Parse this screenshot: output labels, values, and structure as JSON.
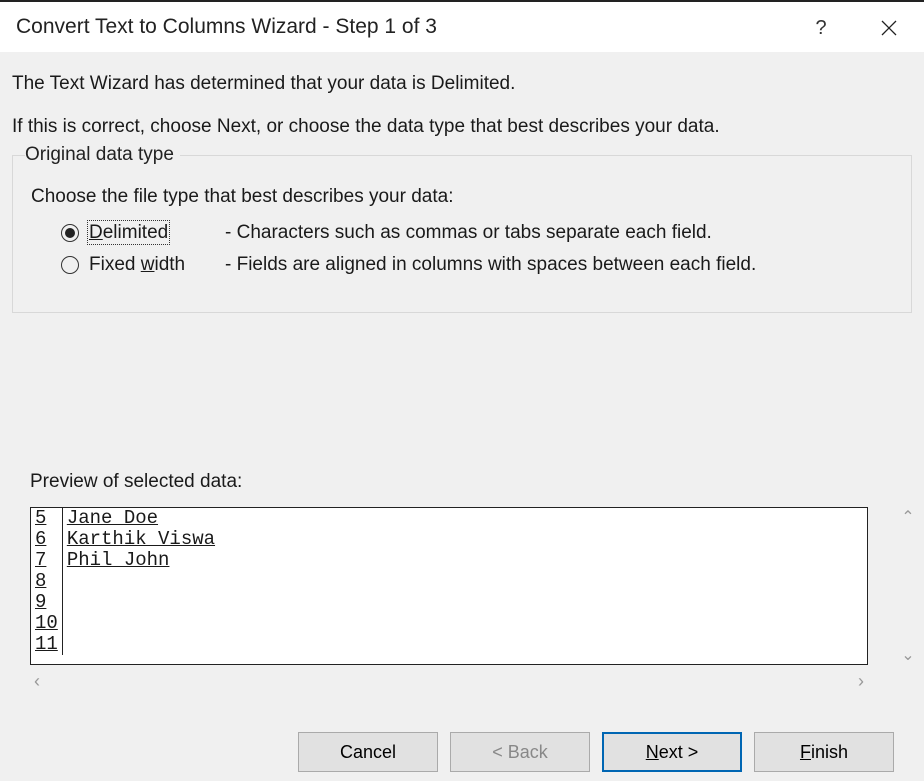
{
  "title": "Convert Text to Columns Wizard - Step 1 of 3",
  "intro": {
    "line1": "The Text Wizard has determined that your data is Delimited.",
    "line2": "If this is correct, choose Next, or choose the data type that best describes your data."
  },
  "fieldset": {
    "legend": "Original data type",
    "prompt": "Choose the file type that best describes your data:",
    "options": [
      {
        "label_pre": "",
        "accel": "D",
        "label_post": "elimited",
        "desc": "- Characters such as commas or tabs separate each field.",
        "checked": true,
        "focused": true
      },
      {
        "label_pre": "Fixed ",
        "accel": "w",
        "label_post": "idth",
        "desc": "- Fields are aligned in columns with spaces between each field.",
        "checked": false,
        "focused": false
      }
    ]
  },
  "preview": {
    "label": "Preview of selected data:",
    "rows": [
      {
        "n": "5",
        "text": "Jane Doe"
      },
      {
        "n": "6",
        "text": "Karthik Viswa"
      },
      {
        "n": "7",
        "text": "Phil John"
      },
      {
        "n": "8",
        "text": ""
      },
      {
        "n": "9",
        "text": ""
      },
      {
        "n": "10",
        "text": ""
      },
      {
        "n": "11",
        "text": ""
      }
    ]
  },
  "buttons": {
    "cancel": "Cancel",
    "back": "< Back",
    "next_pre": "",
    "next_accel": "N",
    "next_post": "ext >",
    "finish_pre": "",
    "finish_accel": "F",
    "finish_post": "inish"
  }
}
